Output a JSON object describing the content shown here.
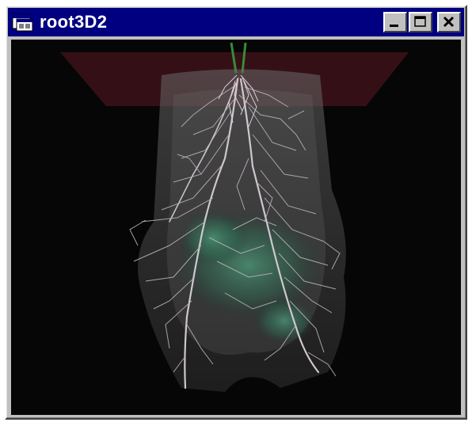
{
  "window": {
    "title": "root3D2",
    "app_icon": "document-window-icon",
    "controls": [
      "minimize-icon",
      "maximize-icon",
      "close-icon"
    ]
  },
  "viewport": {
    "content": "3d-root-system-render",
    "colors": {
      "background": "#060606",
      "soil_plane": "#3a1218",
      "soil_volume": "#5a5a5a",
      "glow": "#3f8f6e",
      "roots": "#c8c0c8"
    }
  }
}
